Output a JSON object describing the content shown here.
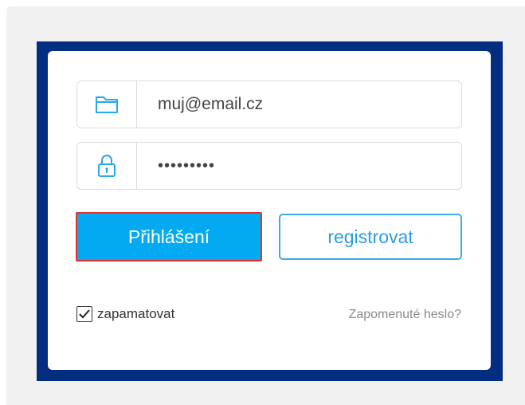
{
  "login_form": {
    "email_value": "muj@email.cz",
    "password_value": "•••••••••",
    "login_label": "Přihlášení",
    "register_label": "registrovat",
    "remember_label": "zapamatovat",
    "remember_checked": true,
    "forgot_label": "Zapomenuté heslo?",
    "icons": {
      "email": "folder-icon",
      "password": "lock-icon"
    }
  },
  "colors": {
    "frame": "#032d7e",
    "accent": "#04aaf1",
    "highlight_border": "#e0322e",
    "icon": "#29a7e6"
  }
}
